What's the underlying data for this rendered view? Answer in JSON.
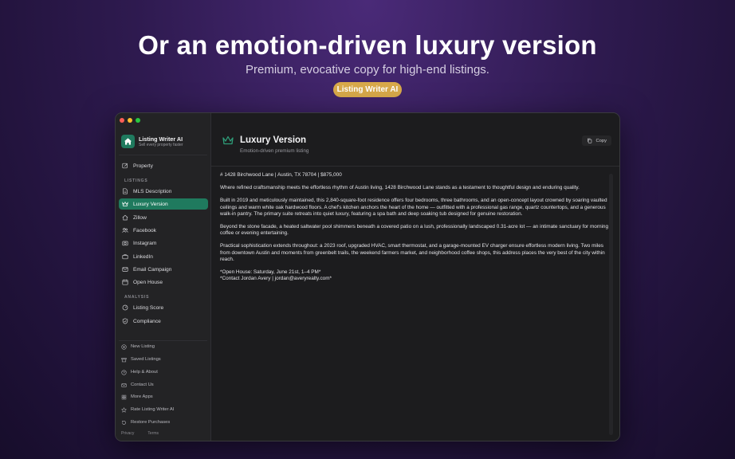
{
  "hero": {
    "title": "Or an emotion-driven luxury version",
    "subtitle": "Premium, evocative copy for high-end listings.",
    "badge": "Listing Writer AI"
  },
  "app": {
    "name": "Listing Writer AI",
    "tagline": "Sell every property faster"
  },
  "sidebar": {
    "property_label": "Property",
    "listings_section": "LISTINGS",
    "listings": [
      {
        "label": "MLS Description",
        "icon": "document-icon"
      },
      {
        "label": "Luxury Version",
        "icon": "crown-icon",
        "active": true
      },
      {
        "label": "Zillow",
        "icon": "house-icon"
      },
      {
        "label": "Facebook",
        "icon": "people-icon"
      },
      {
        "label": "Instagram",
        "icon": "camera-icon"
      },
      {
        "label": "LinkedIn",
        "icon": "briefcase-icon"
      },
      {
        "label": "Email Campaign",
        "icon": "envelope-icon"
      },
      {
        "label": "Open House",
        "icon": "calendar-icon"
      }
    ],
    "analysis_section": "ANALYSIS",
    "analysis": [
      {
        "label": "Listing Score",
        "icon": "gauge-icon"
      },
      {
        "label": "Compliance",
        "icon": "shield-check-icon"
      }
    ],
    "footer": [
      {
        "label": "New Listing",
        "icon": "plus-circle-icon"
      },
      {
        "label": "Saved Listings",
        "icon": "archive-icon"
      },
      {
        "label": "Help & About",
        "icon": "question-icon"
      },
      {
        "label": "Contact Us",
        "icon": "envelope-icon"
      },
      {
        "label": "More Apps",
        "icon": "grid-icon"
      },
      {
        "label": "Rate Listing Writer AI",
        "icon": "star-icon"
      },
      {
        "label": "Restore Purchases",
        "icon": "restore-icon"
      }
    ],
    "privacy": "Privacy",
    "terms": "Terms"
  },
  "main": {
    "title": "Luxury Version",
    "subtitle": "Emotion-driven premium listing",
    "copy_label": "Copy",
    "paragraphs": [
      "# 1428 Birchwood Lane | Austin, TX 78704 | $875,000",
      "Where refined craftsmanship meets the effortless rhythm of Austin living, 1428 Birchwood Lane stands as a testament to thoughtful design and enduring quality.",
      "Built in 2019 and meticulously maintained, this 2,840-square-foot residence offers four bedrooms, three bathrooms, and an open-concept layout crowned by soaring vaulted ceilings and warm white oak hardwood floors. A chef's kitchen anchors the heart of the home — outfitted with a professional gas range, quartz countertops, and a generous walk-in pantry. The primary suite retreats into quiet luxury, featuring a spa bath and deep soaking tub designed for genuine restoration.",
      "Beyond the stone facade, a heated saltwater pool shimmers beneath a covered patio on a lush, professionally landscaped 0.31-acre lot — an intimate sanctuary for morning coffee or evening entertaining.",
      "Practical sophistication extends throughout: a 2023 roof, upgraded HVAC, smart thermostat, and a garage-mounted EV charger ensure effortless modern living. Two miles from downtown Austin and moments from greenbelt trails, the weekend farmers market, and neighborhood coffee shops, this address places the very best of the city within reach."
    ],
    "open_house": "*Open House: Saturday, June 21st, 1–4 PM*",
    "contact": "*Contact Jordan Avery | jordan@averyrealty.com*"
  },
  "colors": {
    "accent": "#1f7a5e",
    "badge": "#d8a94a",
    "crown": "#2e9c78"
  }
}
